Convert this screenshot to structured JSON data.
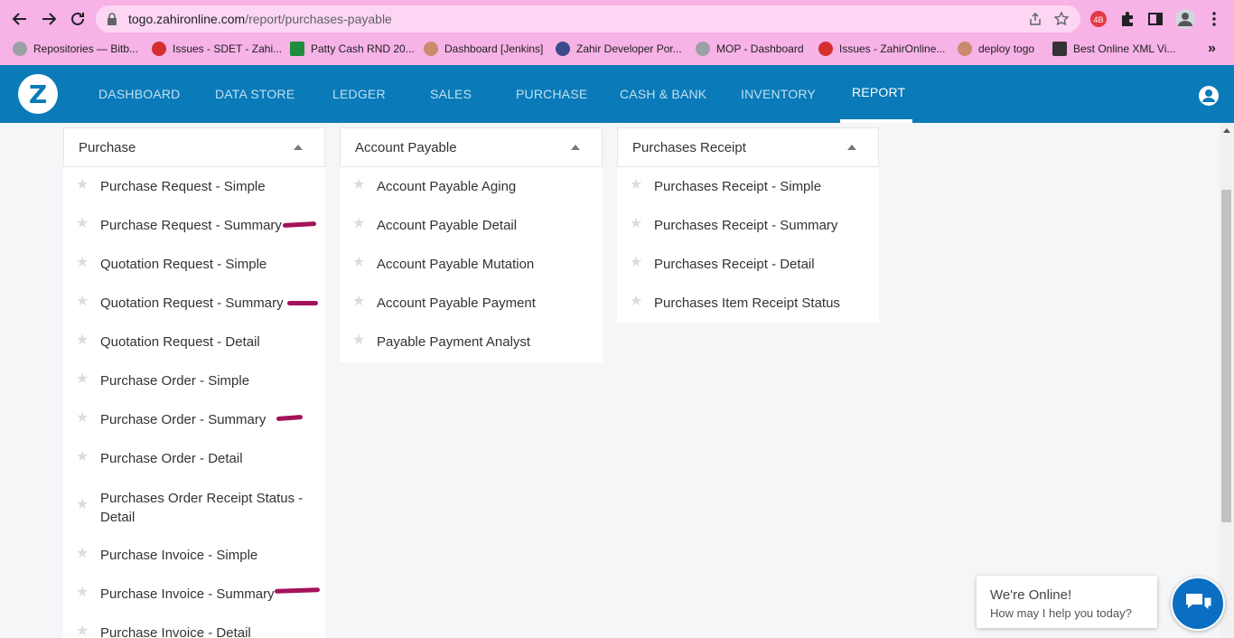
{
  "browser": {
    "url_host": "togo.zahironline.com",
    "url_path": "/report/purchases-payable",
    "bookmarks": [
      {
        "label": "Repositories — Bitb...",
        "color": "#9aa0a6"
      },
      {
        "label": "Issues - SDET - Zahi...",
        "color": "#d32f2f"
      },
      {
        "label": "Patty Cash RND 20...",
        "color": "#1e8e3e"
      },
      {
        "label": "Dashboard [Jenkins]",
        "color": "#c98b6b"
      },
      {
        "label": "Zahir Developer Por...",
        "color": "#3c4a8c"
      },
      {
        "label": "MOP - Dashboard",
        "color": "#9aa0a6"
      },
      {
        "label": "Issues - ZahirOnline...",
        "color": "#d32f2f"
      },
      {
        "label": "deploy togo",
        "color": "#c98b6b"
      },
      {
        "label": "Best Online XML Vi...",
        "color": "#333333"
      }
    ],
    "more_label": "»"
  },
  "nav": {
    "logo": "Z",
    "items": [
      "DASHBOARD",
      "DATA STORE",
      "LEDGER",
      "SALES",
      "PURCHASE",
      "CASH & BANK",
      "INVENTORY",
      "REPORT"
    ],
    "active": "REPORT"
  },
  "panels": [
    {
      "title": "Purchase",
      "items": [
        "Purchase Request - Simple",
        "Purchase Request - Summary",
        "Quotation Request - Simple",
        "Quotation Request - Summary",
        "Quotation Request - Detail",
        "Purchase Order - Simple",
        "Purchase Order - Summary",
        "Purchase Order - Detail",
        "Purchases Order Receipt Status - Detail",
        "Purchase Invoice - Simple",
        "Purchase Invoice - Summary",
        "Purchase Invoice - Detail"
      ]
    },
    {
      "title": "Account Payable",
      "items": [
        "Account Payable Aging",
        "Account Payable Detail",
        "Account Payable Mutation",
        "Account Payable Payment",
        "Payable Payment Analyst"
      ]
    },
    {
      "title": "Purchases Receipt",
      "items": [
        "Purchases Receipt - Simple",
        "Purchases Receipt - Summary",
        "Purchases Receipt - Detail",
        "Purchases Item Receipt Status"
      ]
    }
  ],
  "chat": {
    "line1": "We're Online!",
    "line2": "How may I help you today?"
  },
  "colors": {
    "browser_bg": "#f7b2e6",
    "appbar": "#0a7ab8",
    "annotation_mark": "#a4125a"
  }
}
